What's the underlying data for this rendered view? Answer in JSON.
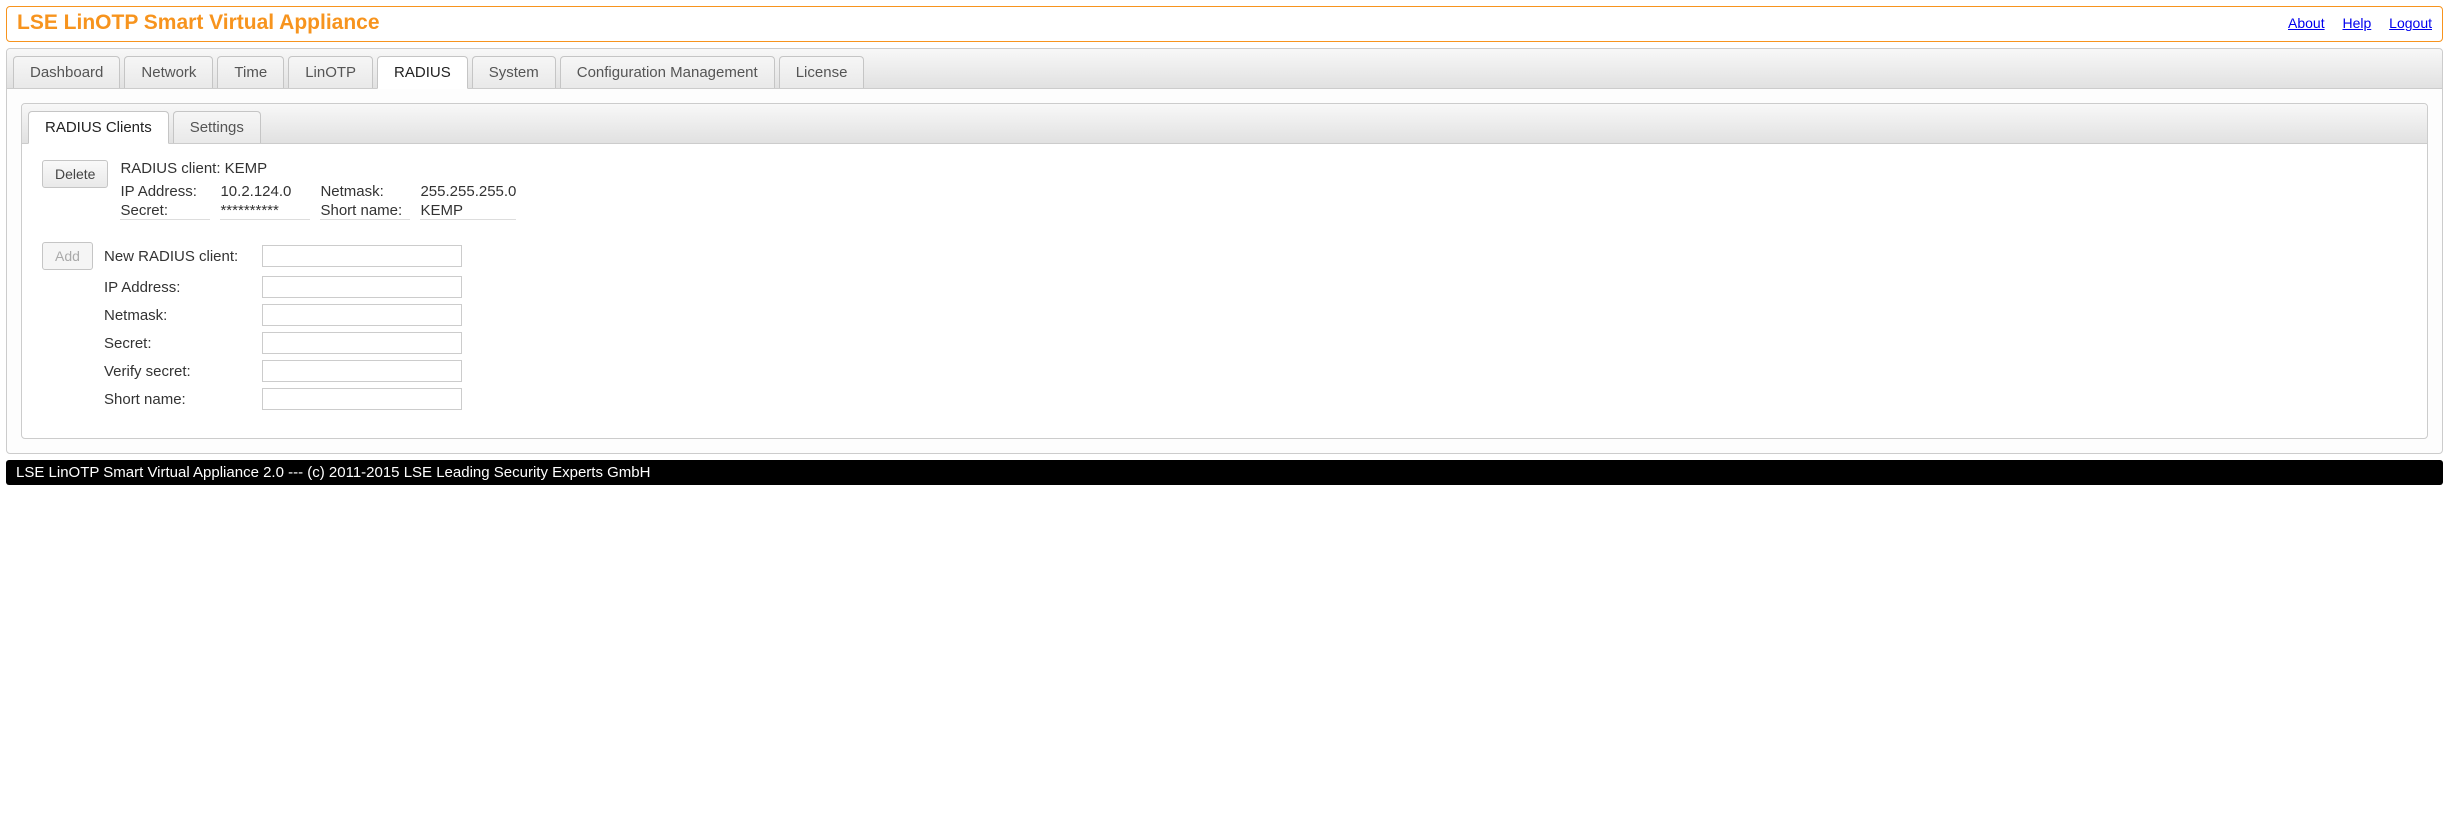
{
  "header": {
    "title": "LSE LinOTP Smart Virtual Appliance",
    "links": {
      "about": "About",
      "help": "Help",
      "logout": "Logout"
    }
  },
  "tabs": {
    "dashboard": "Dashboard",
    "network": "Network",
    "time": "Time",
    "linotp": "LinOTP",
    "radius": "RADIUS",
    "system": "System",
    "config_mgmt": "Configuration Management",
    "license": "License"
  },
  "inner_tabs": {
    "radius_clients": "RADIUS Clients",
    "settings": "Settings"
  },
  "client": {
    "delete_btn": "Delete",
    "title_prefix": "RADIUS client: ",
    "name": "KEMP",
    "ip_label": "IP Address:",
    "ip_value": "10.2.124.0",
    "netmask_label": "Netmask:",
    "netmask_value": "255.255.255.0",
    "secret_label": "Secret:",
    "secret_value": "**********",
    "shortname_label": "Short name:",
    "shortname_value": "KEMP"
  },
  "form": {
    "add_btn": "Add",
    "new_label": "New RADIUS client:",
    "ip_label": "IP Address:",
    "netmask_label": "Netmask:",
    "secret_label": "Secret:",
    "verify_label": "Verify secret:",
    "shortname_label": "Short name:"
  },
  "footer": "LSE LinOTP Smart Virtual Appliance 2.0 --- (c) 2011-2015 LSE Leading Security Experts GmbH"
}
